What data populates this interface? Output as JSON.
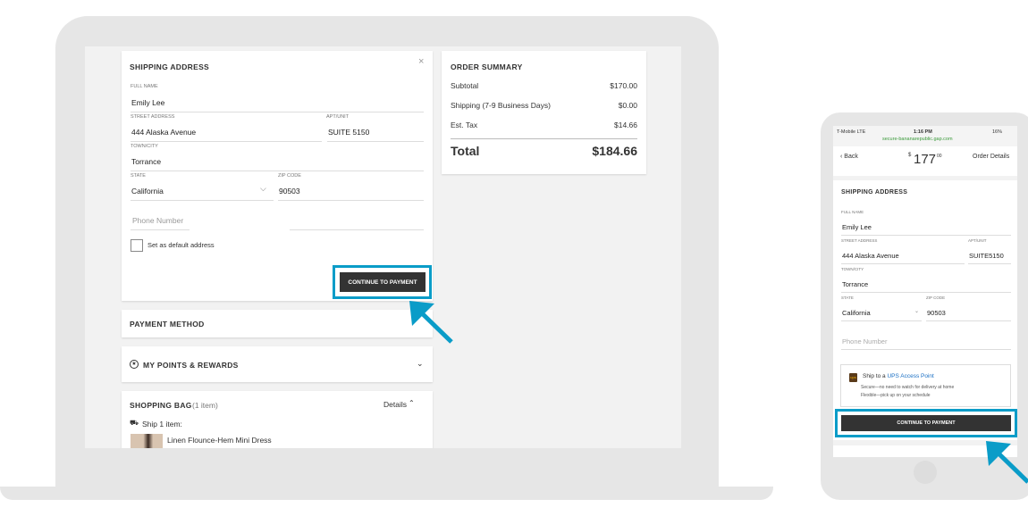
{
  "desktop": {
    "shipping": {
      "title": "SHIPPING ADDRESS",
      "full_name_label": "FULL NAME",
      "full_name": "Emily Lee",
      "street_label": "STREET ADDRESS",
      "street": "444 Alaska Avenue",
      "apt_label": "APT/UNIT",
      "apt": "SUITE 5150",
      "city_label": "TOWN/CITY",
      "city": "Torrance",
      "state_label": "STATE",
      "state": "California",
      "zip_label": "ZIP CODE",
      "zip": "90503",
      "phone_placeholder": "Phone Number",
      "default_label": "Set as default address",
      "continue": "CONTINUE TO PAYMENT"
    },
    "payment": {
      "title": "PAYMENT METHOD"
    },
    "rewards": {
      "title": "MY POINTS & REWARDS"
    },
    "bag": {
      "title": "SHOPPING BAG",
      "count": "(1 item)",
      "details": "Details",
      "ship": "Ship 1 item:",
      "item": "Linen Flounce-Hem Mini Dress"
    },
    "summary": {
      "title": "ORDER SUMMARY",
      "rows": [
        {
          "label": "Subtotal",
          "value": "$170.00"
        },
        {
          "label": "Shipping (7-9 Business Days)",
          "value": "$0.00"
        },
        {
          "label": "Est. Tax",
          "value": "$14.66"
        }
      ],
      "total_label": "Total",
      "total": "$184.66"
    }
  },
  "mobile": {
    "status": {
      "carrier": "T-Mobile  LTE",
      "time": "1:16 PM",
      "battery": "16%",
      "url": "secure-bananarepublic.gap.com"
    },
    "nav": {
      "back": "Back",
      "price_symbol": "$",
      "price": "177",
      "price_cents": "00",
      "details": "Order Details"
    },
    "shipping": {
      "title": "SHIPPING ADDRESS",
      "full_name_label": "FULL NAME",
      "full_name": "Emily Lee",
      "street_label": "STREET ADDRESS",
      "street": "444 Alaska Avenue",
      "apt_label": "APT/UNIT",
      "apt": "SUITE5150",
      "city_label": "TOWN/CITY",
      "city": "Torrance",
      "state_label": "STATE",
      "state": "California",
      "zip_label": "ZIP CODE",
      "zip": "90503",
      "phone_placeholder": "Phone Number"
    },
    "ups": {
      "prefix": "Ship to a ",
      "link": "UPS Access Point",
      "line1": "Secure—no need to watch for delivery at home",
      "line2": "Flexible—pick up on your schedule"
    },
    "continue": "CONTINUE TO PAYMENT"
  },
  "colors": {
    "highlight": "#0a9cc8",
    "button": "#333333",
    "link": "#1a6fc4",
    "url_green": "#3a9a3a"
  }
}
